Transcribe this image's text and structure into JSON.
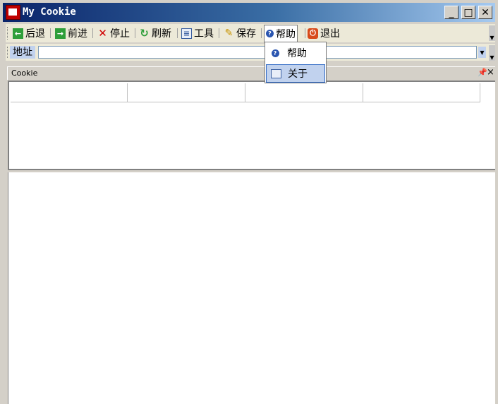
{
  "window": {
    "title": "My Cookie"
  },
  "toolbar": {
    "back": "后退",
    "forward": "前进",
    "stop": "停止",
    "refresh": "刷新",
    "tools": "工具",
    "save": "保存",
    "help": "帮助",
    "exit": "退出"
  },
  "address": {
    "label": "地址",
    "value": ""
  },
  "panel": {
    "title": "Cookie",
    "columns": [
      "",
      "",
      "",
      ""
    ]
  },
  "menu": {
    "items": [
      "帮助",
      "关于"
    ]
  },
  "colors": {
    "titlebar_start": "#0a246a",
    "titlebar_end": "#a6caf0",
    "menu_highlight": "#c1d2ee"
  }
}
